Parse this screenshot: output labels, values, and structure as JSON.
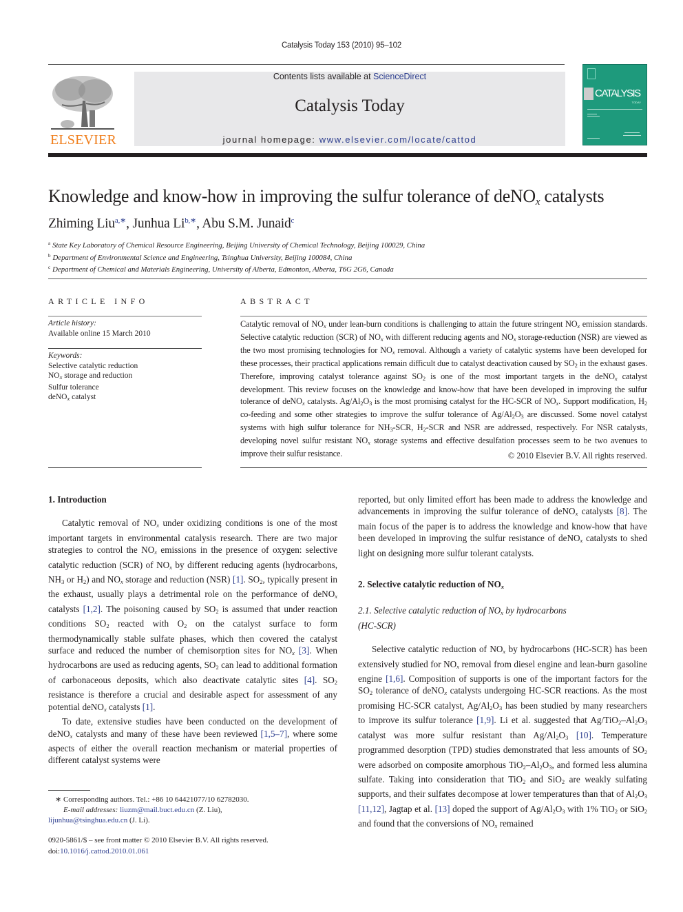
{
  "running_head": "Catalysis Today 153 (2010) 95–102",
  "masthead": {
    "contents_prefix": "Contents lists available at ",
    "contents_link": "ScienceDirect",
    "journal_title": "Catalysis Today",
    "homepage_prefix": "journal homepage: ",
    "homepage_link": "www.elsevier.com/locate/cattod",
    "publisher_logo_text": "ELSEVIER",
    "cover_title": "CATALYSIS",
    "cover_subtitle": "TODAY",
    "brand_color": "#f07f1d",
    "cover_color": "#1e9a7c",
    "link_color": "#2d3e8f"
  },
  "article": {
    "title_main": "Knowledge and know-how in improving the sulfur tolerance of deNO",
    "title_sub": "x",
    "title_end": " catalysts",
    "authors": [
      {
        "name": "Zhiming Liu",
        "sup": "a,∗"
      },
      {
        "name": "Junhua Li",
        "sup": "b,∗"
      },
      {
        "name": "Abu S.M. Junaid",
        "sup": "c"
      }
    ],
    "affiliations": [
      {
        "key": "a",
        "text": "State Key Laboratory of Chemical Resource Engineering, Beijing University of Chemical Technology, Beijing 100029, China"
      },
      {
        "key": "b",
        "text": "Department of Environmental Science and Engineering, Tsinghua University, Beijing 100084, China"
      },
      {
        "key": "c",
        "text": "Department of Chemical and Materials Engineering, University of Alberta, Edmonton, Alberta, T6G 2G6, Canada"
      }
    ]
  },
  "article_info": {
    "heading": "ARTICLE INFO",
    "history_label": "Article history:",
    "history_value": "Available online 15 March 2010",
    "keywords_label": "Keywords:",
    "keywords": [
      "Selective catalytic reduction",
      "NOx storage and reduction",
      "Sulfur tolerance",
      "deNOx catalyst"
    ]
  },
  "abstract": {
    "heading": "ABSTRACT",
    "text": "Catalytic removal of NOx under lean-burn conditions is challenging to attain the future stringent NOx emission standards. Selective catalytic reduction (SCR) of NOx with different reducing agents and NOx storage-reduction (NSR) are viewed as the two most promising technologies for NOx removal. Although a variety of catalytic systems have been developed for these processes, their practical applications remain difficult due to catalyst deactivation caused by SO2 in the exhaust gases. Therefore, improving catalyst tolerance against SO2 is one of the most important targets in the deNOx catalyst development. This review focuses on the knowledge and know-how that have been developed in improving the sulfur tolerance of deNOx catalysts. Ag/Al2O3 is the most promising catalyst for the HC-SCR of NOx. Support modification, H2 co-feeding and some other strategies to improve the sulfur tolerance of Ag/Al2O3 are discussed. Some novel catalyst systems with high sulfur tolerance for NH3-SCR, H2-SCR and NSR are addressed, respectively. For NSR catalysts, developing novel sulfur resistant NOx storage systems and effective desulfation processes seem to be two avenues to improve their sulfur resistance.",
    "copyright": "© 2010 Elsevier B.V. All rights reserved."
  },
  "body": {
    "section1_heading": "1.  Introduction",
    "section1_p1": "Catalytic removal of NOx under oxidizing conditions is one of the most important targets in environmental catalysis research. There are two major strategies to control the NOx emissions in the presence of oxygen: selective catalytic reduction (SCR) of NOx by different reducing agents (hydrocarbons, NH3 or H2) and NOx storage and reduction (NSR) [1]. SO2, typically present in the exhaust, usually plays a detrimental role on the performance of deNOx catalysts [1,2]. The poisoning caused by SO2 is assumed that under reaction conditions SO2 reacted with O2 on the catalyst surface to form thermodynamically stable sulfate phases, which then covered the catalyst surface and reduced the number of chemisorption sites for NOx [3]. When hydrocarbons are used as reducing agents, SO2 can lead to additional formation of carbonaceous deposits, which also deactivate catalytic sites [4]. SO2 resistance is therefore a crucial and desirable aspect for assessment of any potential deNOx catalysts [1].",
    "section1_p2": "To date, extensive studies have been conducted on the development of deNOx catalysts and many of these have been reviewed [1,5–7], where some aspects of either the overall reaction mechanism or material properties of different catalyst systems were reported, but only limited effort has been made to address the knowledge and advancements in improving the sulfur tolerance of deNOx catalysts [8]. The main focus of the paper is to address the knowledge and know-how that have been developed in improving the sulfur resistance of deNOx catalysts to shed light on designing more sulfur tolerant catalysts.",
    "section2_heading": "2.  Selective catalytic reduction of NOx",
    "section21_heading": "2.1.  Selective catalytic reduction of NOx by hydrocarbons (HC-SCR)",
    "section21_p1": "Selective catalytic reduction of NOx by hydrocarbons (HC-SCR) has been extensively studied for NOx removal from diesel engine and lean-burn gasoline engine [1,6]. Composition of supports is one of the important factors for the SO2 tolerance of deNOx catalysts undergoing HC-SCR reactions. As the most promising HC-SCR catalyst, Ag/Al2O3 has been studied by many researchers to improve its sulfur tolerance [1,9]. Li et al. suggested that Ag/TiO2–Al2O3 catalyst was more sulfur resistant than Ag/Al2O3 [10]. Temperature programmed desorption (TPD) studies demonstrated that less amounts of SO2 were adsorbed on composite amorphous TiO2–Al2O3, and formed less alumina sulfate. Taking into consideration that TiO2 and SiO2 are weakly sulfating supports, and their sulfates decompose at lower temperatures than that of Al2O3 [11,12], Jagtap et al. [13] doped the support of Ag/Al2O3 with 1% TiO2 or SiO2 and found that the conversions of NOx remained"
  },
  "footnotes": {
    "corresponding": "∗ Corresponding authors. Tel.: +86 10 64421077/10 62782030.",
    "email_label": "E-mail addresses:",
    "email1": "liuzm@mail.buct.edu.cn",
    "email1_owner": " (Z. Liu),",
    "email2": "lijunhua@tsinghua.edu.cn",
    "email2_owner": " (J. Li).",
    "issn_line": "0920-5861/$ – see front matter © 2010 Elsevier B.V. All rights reserved.",
    "doi_prefix": "doi:",
    "doi_link": "10.1016/j.cattod.2010.01.061"
  }
}
